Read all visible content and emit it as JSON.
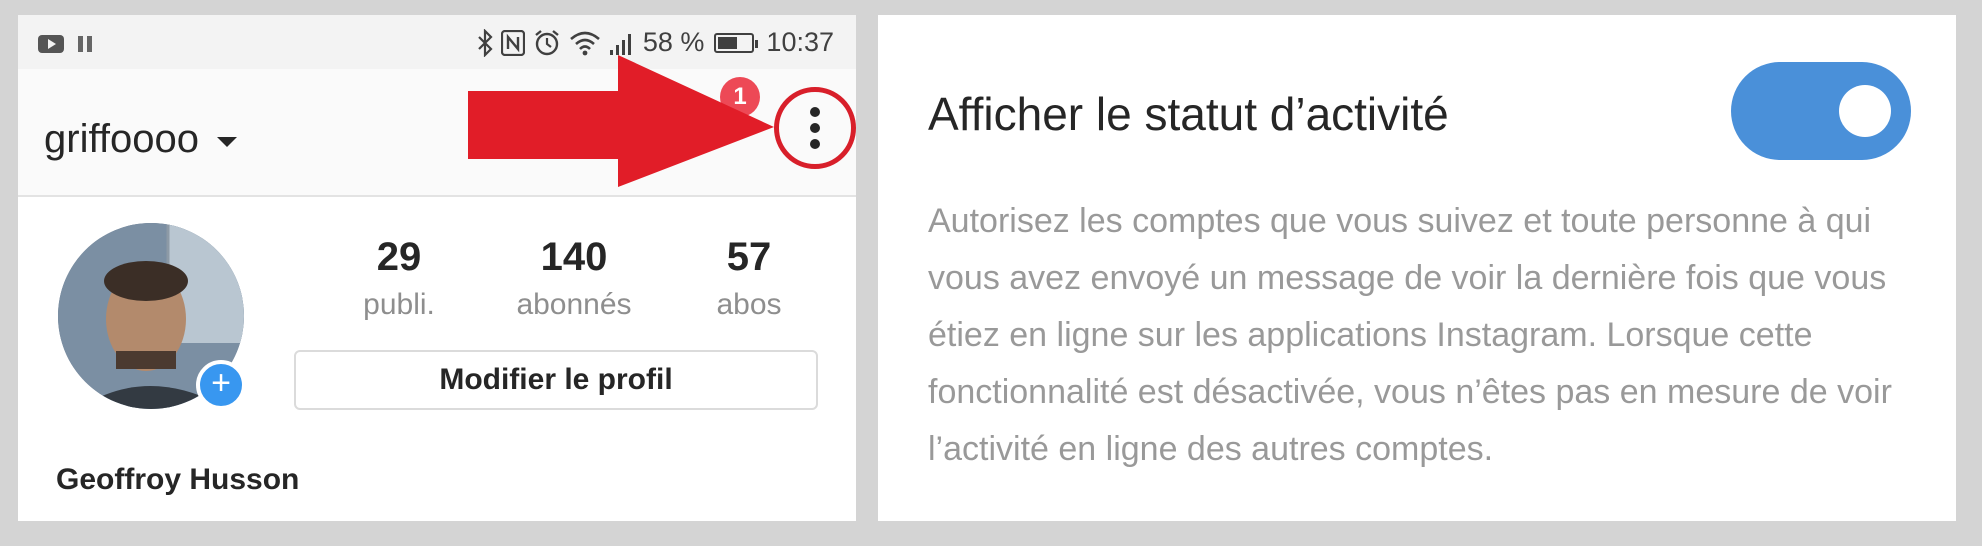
{
  "statusbar": {
    "battery_percent": "58 %",
    "time": "10:37",
    "battery_level": 0.58,
    "icons": [
      "youtube-icon",
      "pause-icon",
      "bluetooth-icon",
      "nfc-icon",
      "alarm-icon",
      "wifi-icon",
      "signal-icon",
      "battery-icon"
    ]
  },
  "profile": {
    "username": "griffoooo",
    "notification_count": "1",
    "stats": [
      {
        "value": "29",
        "label": "publi."
      },
      {
        "value": "140",
        "label": "abonnés"
      },
      {
        "value": "57",
        "label": "abos"
      }
    ],
    "edit_button": "Modifier le profil",
    "full_name": "Geoffroy Husson",
    "add_badge": "+"
  },
  "settings": {
    "title": "Afficher le statut d’activité",
    "toggle_on": true,
    "description": "Autorisez les comptes que vous suivez et toute personne à qui vous avez envoyé un message de voir la dernière fois que vous étiez en ligne sur les applications Instagram. Lorsque cette fonctionnalité est désactivée, vous n’êtes pas en mesure de voir l’activité en ligne des autres comptes."
  },
  "colors": {
    "accent_blue": "#3897f0",
    "toggle_blue": "#4a90d9",
    "annotation_red": "#e11d28",
    "badge_red": "#ed4956"
  }
}
